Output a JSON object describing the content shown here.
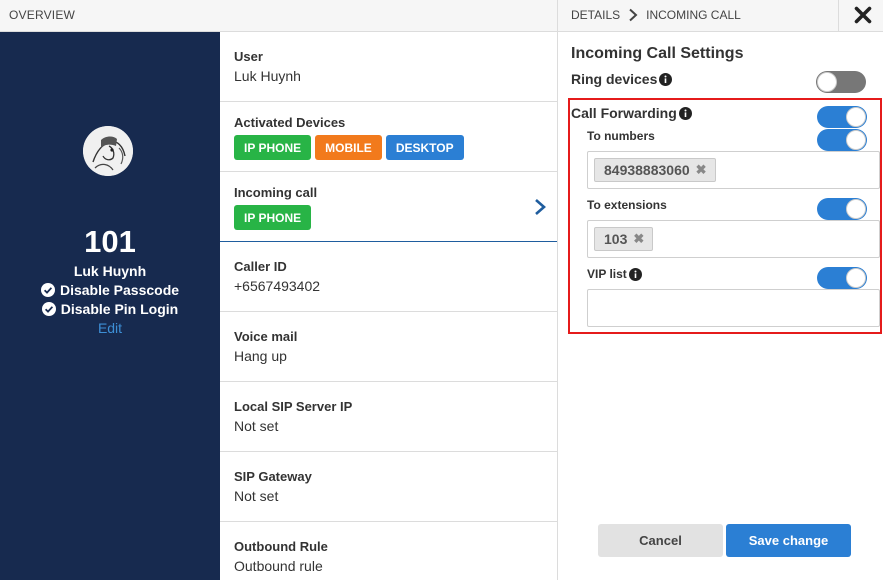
{
  "topbar": {
    "overview": "OVERVIEW",
    "details": "DETAILS",
    "incoming_call": "INCOMING CALL",
    "close_icon": "close-icon"
  },
  "profile": {
    "extension": "101",
    "name": "Luk Huynh",
    "option1": "Disable Passcode",
    "option2": "Disable Pin Login",
    "edit": "Edit"
  },
  "details": {
    "user_label": "User",
    "user_value": "Luk Huynh",
    "devices_label": "Activated Devices",
    "devices": [
      {
        "label": "IP PHONE",
        "color": "#28b446"
      },
      {
        "label": "MOBILE",
        "color": "#f27a1c"
      },
      {
        "label": "DESKTOP",
        "color": "#2b7fd4"
      }
    ],
    "incoming_label": "Incoming call",
    "incoming_badge": "IP PHONE",
    "caller_id_label": "Caller ID",
    "caller_id_value": "+6567493402",
    "voicemail_label": "Voice mail",
    "voicemail_value": "Hang up",
    "sip_ip_label": "Local SIP Server IP",
    "sip_ip_value": "Not set",
    "sip_gateway_label": "SIP Gateway",
    "sip_gateway_value": "Not set",
    "outbound_label": "Outbound Rule",
    "outbound_value": "Outbound rule"
  },
  "settings": {
    "title": "Incoming Call Settings",
    "ring_devices": "Ring devices",
    "call_forwarding": "Call Forwarding",
    "to_numbers": "To numbers",
    "to_numbers_tag": "84938883060",
    "to_extensions": "To extensions",
    "to_extensions_tag": "103",
    "vip_list": "VIP list",
    "toggles": {
      "ring_devices": false,
      "call_forwarding": true,
      "to_numbers": true,
      "to_extensions": true,
      "vip_list": true
    },
    "cancel": "Cancel",
    "save": "Save change"
  },
  "colors": {
    "sidebar": "#172a4f",
    "accent": "#2b7fd4",
    "highlight_border": "#e51b1b"
  }
}
